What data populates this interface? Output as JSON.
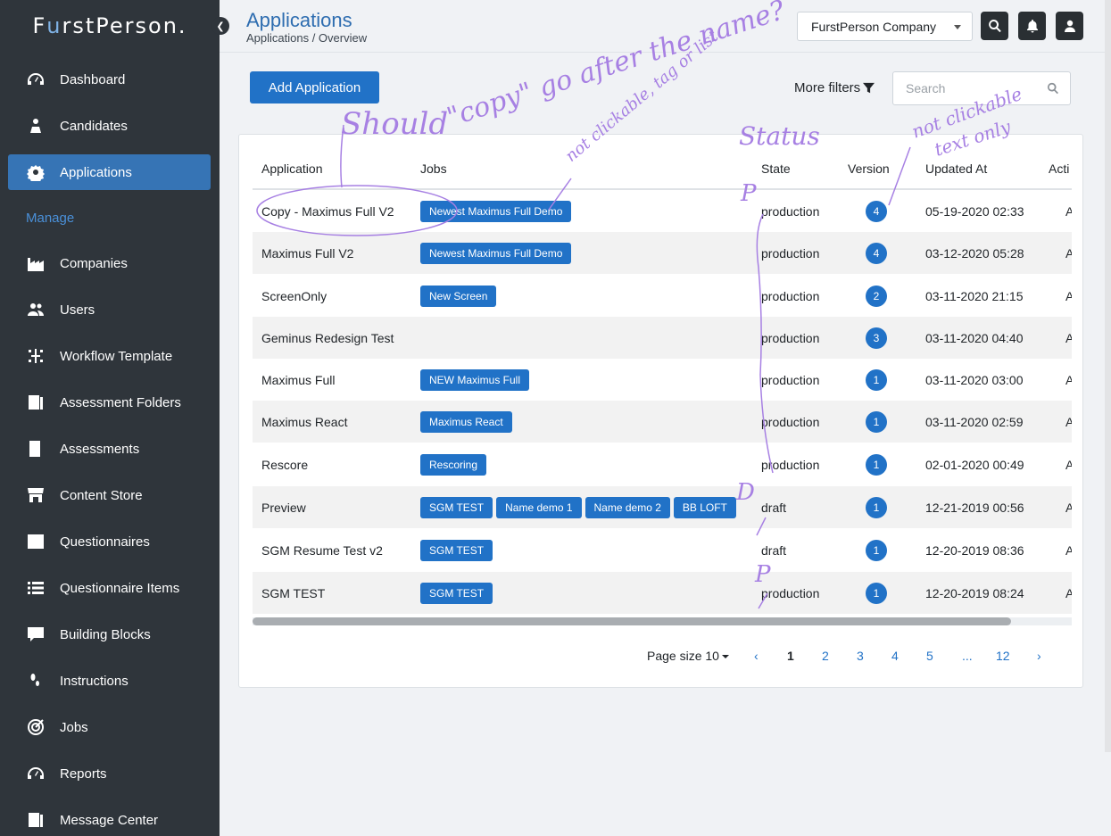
{
  "brand": {
    "logo_pre": "F",
    "logo_u": "u",
    "logo_post": "rstPerson."
  },
  "sidebar": {
    "items": [
      {
        "label": "Dashboard",
        "icon": "dashboard-icon"
      },
      {
        "label": "Candidates",
        "icon": "candidates-icon"
      },
      {
        "label": "Applications",
        "icon": "applications-icon",
        "active": true
      },
      {
        "label": "Companies",
        "icon": "companies-icon"
      },
      {
        "label": "Users",
        "icon": "users-icon"
      },
      {
        "label": "Workflow Template",
        "icon": "workflow-icon"
      },
      {
        "label": "Assessment Folders",
        "icon": "folders-icon"
      },
      {
        "label": "Assessments",
        "icon": "assessments-icon"
      },
      {
        "label": "Content Store",
        "icon": "store-icon"
      },
      {
        "label": "Questionnaires",
        "icon": "questionnaires-icon"
      },
      {
        "label": "Questionnaire Items",
        "icon": "list-icon"
      },
      {
        "label": "Building Blocks",
        "icon": "blocks-icon"
      },
      {
        "label": "Instructions",
        "icon": "footsteps-icon"
      },
      {
        "label": "Jobs",
        "icon": "target-icon"
      },
      {
        "label": "Reports",
        "icon": "reports-icon"
      },
      {
        "label": "Message Center",
        "icon": "message-icon"
      }
    ],
    "section_label": "Manage"
  },
  "header": {
    "title": "Applications",
    "breadcrumb": "Applications / Overview",
    "company": "FurstPerson Company"
  },
  "toolbar": {
    "add_label": "Add Application",
    "more_filters": "More filters",
    "search_placeholder": "Search"
  },
  "table": {
    "columns": [
      "Application",
      "Jobs",
      "State",
      "Version",
      "Updated At",
      "Acti"
    ],
    "rows": [
      {
        "application": "Copy - Maximus Full V2",
        "jobs": [
          "Newest Maximus Full Demo"
        ],
        "state": "production",
        "version": "4",
        "updated": "05-19-2020 02:33",
        "action": "A"
      },
      {
        "application": "Maximus Full V2",
        "jobs": [
          "Newest Maximus Full Demo"
        ],
        "state": "production",
        "version": "4",
        "updated": "03-12-2020 05:28",
        "action": "A"
      },
      {
        "application": "ScreenOnly",
        "jobs": [
          "New Screen"
        ],
        "state": "production",
        "version": "2",
        "updated": "03-11-2020 21:15",
        "action": "A"
      },
      {
        "application": "Geminus Redesign Test",
        "jobs": [],
        "state": "production",
        "version": "3",
        "updated": "03-11-2020 04:40",
        "action": "A"
      },
      {
        "application": "Maximus Full",
        "jobs": [
          "NEW Maximus Full"
        ],
        "state": "production",
        "version": "1",
        "updated": "03-11-2020 03:00",
        "action": "A"
      },
      {
        "application": "Maximus React",
        "jobs": [
          "Maximus React"
        ],
        "state": "production",
        "version": "1",
        "updated": "03-11-2020 02:59",
        "action": "A"
      },
      {
        "application": "Rescore",
        "jobs": [
          "Rescoring"
        ],
        "state": "production",
        "version": "1",
        "updated": "02-01-2020 00:49",
        "action": "A"
      },
      {
        "application": "Preview",
        "jobs": [
          "SGM TEST",
          "Name demo 1",
          "Name demo 2",
          "BB LOFT"
        ],
        "state": "draft",
        "version": "1",
        "updated": "12-21-2019 00:56",
        "action": "A"
      },
      {
        "application": "SGM Resume Test v2",
        "jobs": [
          "SGM TEST"
        ],
        "state": "draft",
        "version": "1",
        "updated": "12-20-2019 08:36",
        "action": "A"
      },
      {
        "application": "SGM TEST",
        "jobs": [
          "SGM TEST"
        ],
        "state": "production",
        "version": "1",
        "updated": "12-20-2019 08:24",
        "action": "A"
      }
    ]
  },
  "pagination": {
    "page_size_label": "Page size",
    "page_size": "10",
    "prev": "‹",
    "pages": [
      "1",
      "2",
      "3",
      "4",
      "5",
      "...",
      "12"
    ],
    "next": "›",
    "current": "1"
  },
  "annotations": {
    "copy_note_1": "Should",
    "copy_note_2": "\"copy\" go after the name?",
    "jobs_note": "not clickable, tag or list",
    "status_note": "Status",
    "version_note_1": "not clickable",
    "version_note_2": "text only",
    "state_marks": [
      "P",
      "D",
      "P"
    ]
  },
  "colors": {
    "primary": "#2172c7",
    "sidebar_bg": "#2f353b",
    "annotation": "#a780e3"
  }
}
